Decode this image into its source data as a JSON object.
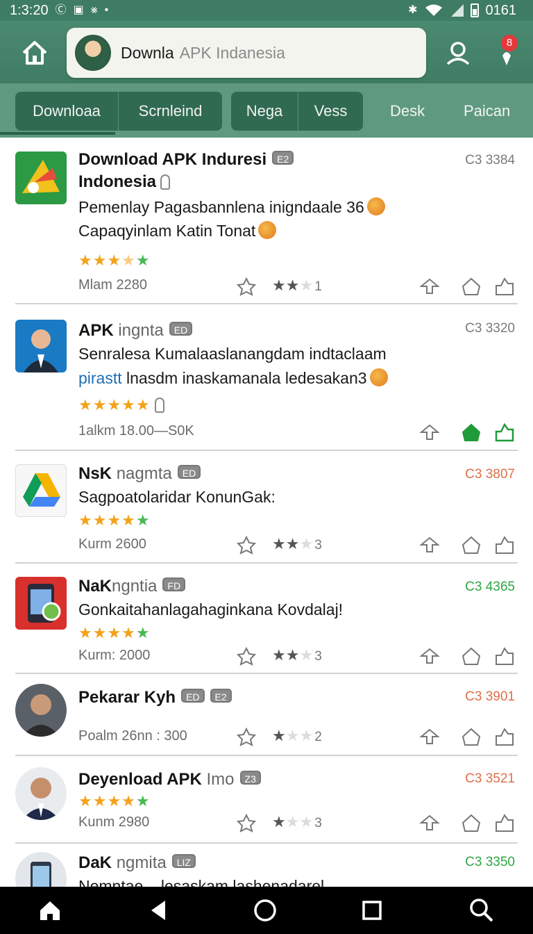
{
  "status_bar": {
    "time": "1:3:20",
    "battery": "0161",
    "icons": [
      "sync-icon",
      "image-icon",
      "translate-icon",
      "dot-icon",
      "bluetooth-icon",
      "wifi-icon",
      "signal-icon",
      "battery-icon"
    ]
  },
  "header": {
    "search_query": "Downla",
    "search_placeholder": "APK Indanesia",
    "notification_badge": "8"
  },
  "tabs": [
    {
      "label": "Downloaa",
      "active": true
    },
    {
      "label": "Scrnleind"
    },
    {
      "label": "Nega"
    },
    {
      "label": "Vess"
    },
    {
      "label": "Desk"
    },
    {
      "label": "Paican"
    }
  ],
  "items": [
    {
      "title": "Download APK Induresi",
      "title_line2": "Indonesia",
      "tag": "E2",
      "count": "C3 3384",
      "count_color": "#7a7a7a",
      "desc1": "Pemenlay Pagasbannlena inigndaale 36",
      "desc2": "Capaqyinlam Katin Tonat",
      "stars": "3.5/5",
      "meta": "Mlam 2280",
      "rate_count": "1",
      "rate_filled": 2
    },
    {
      "title": "APK",
      "title_light": "ingnta",
      "tag": "ED",
      "count": "C3 3320",
      "count_color": "#7a7a7a",
      "desc1": "Senralesa Kumalaaslanangdam indtaclaam",
      "desc2_blue": "pirastt",
      "desc2": "lnasdm inaskamanala ledesakan3",
      "stars": "5/5",
      "meta": "1alkm 18.00—S0K"
    },
    {
      "title": "NsK",
      "title_light": "nagmta",
      "tag": "ED",
      "count": "C3 3807",
      "count_color": "#de6f4a",
      "desc1": "Sagpoatolaridar KonunGak:",
      "stars": "5/5",
      "meta": "Kurm 2600",
      "rate_count": "3",
      "rate_filled": 2
    },
    {
      "title": "NaK",
      "title_light": "ngntia",
      "tag": "FD",
      "count": "C3 4365",
      "count_color": "#2fa643",
      "desc1": "Gonkaitahanlagahaginkana Kovdalaj!",
      "stars": "5/5",
      "meta": "Kurm: 2000",
      "rate_count": "3",
      "rate_filled": 2
    },
    {
      "title": "Pekarar Kyh",
      "tag": "ED",
      "tag2": "E2",
      "count": "C3 3901",
      "count_color": "#de6f4a",
      "meta": "Poalm 26nn : 300",
      "rate_count": "2",
      "rate_filled": 1
    },
    {
      "title": "Deyenload APK",
      "title_light": "Imo",
      "tag": "Z3",
      "count": "C3 3521",
      "count_color": "#de6f4a",
      "stars": "5/5",
      "meta": "Kunm 2980",
      "rate_count": "3",
      "rate_filled": 1
    },
    {
      "title": "DaK",
      "title_light": "ngmita",
      "tag": "LIZ",
      "count": "C3 3350",
      "count_color": "#2fa643",
      "desc1": "Nemntae...  lesaskam lashenadarel"
    }
  ],
  "colors": {
    "header_green": "#3f7c64",
    "tab_dark": "#2f6a51",
    "star_orange": "#f3a21a",
    "star_green": "#49b755",
    "active_green": "#1f9b3a"
  },
  "nav": [
    "home-icon",
    "back-icon",
    "circle-home-icon",
    "recents-icon",
    "search-icon"
  ]
}
